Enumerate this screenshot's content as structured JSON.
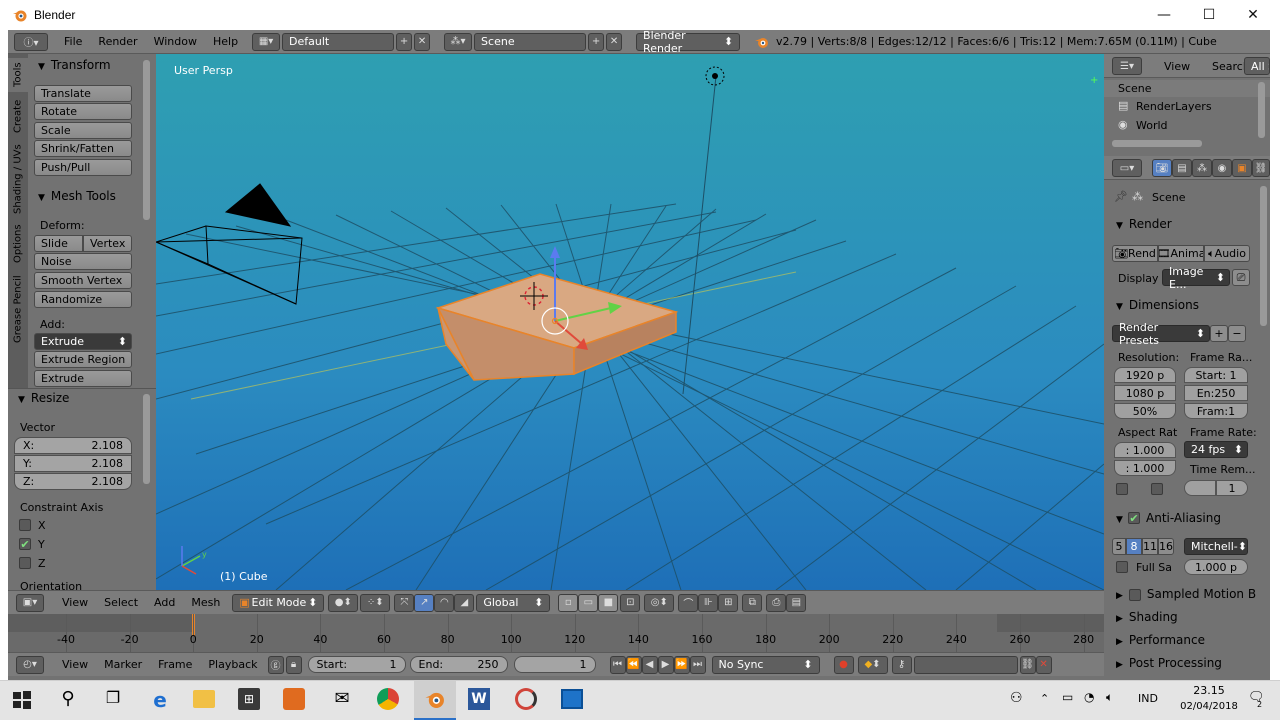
{
  "window": {
    "title": "Blender",
    "minimize": "—",
    "maximize": "☐",
    "close": "✕"
  },
  "infobar": {
    "menus": [
      "File",
      "Render",
      "Window",
      "Help"
    ],
    "layout": "Default",
    "scene": "Scene",
    "engine": "Blender Render",
    "stats": "v2.79 | Verts:8/8 | Edges:12/12 | Faces:6/6 | Tris:12 | Mem:7.65M (0.11M) | Cube"
  },
  "tabs": [
    "Tools",
    "Create",
    "Shading / UVs",
    "Options",
    "Grease Pencil"
  ],
  "toolpanel": {
    "transform_title": "Transform",
    "transform_buttons": [
      "Translate",
      "Rotate",
      "Scale",
      "Shrink/Fatten",
      "Push/Pull"
    ],
    "meshtools_title": "Mesh Tools",
    "deform_label": "Deform:",
    "slide_edge": "Slide Ed",
    "vertex": "Vertex",
    "deform_buttons": [
      "Noise",
      "Smooth Vertex",
      "Randomize"
    ],
    "add_label": "Add:",
    "extrude_select": "Extrude",
    "add_buttons": [
      "Extrude Region",
      "Extrude Individual"
    ]
  },
  "resize": {
    "title": "Resize",
    "vector_label": "Vector",
    "x_label": "X:",
    "x_value": "2.108",
    "y_label": "Y:",
    "y_value": "2.108",
    "z_label": "Z:",
    "z_value": "2.108",
    "constraint_label": "Constraint Axis",
    "axes": [
      "X",
      "Y",
      "Z"
    ],
    "axis_checked": [
      false,
      true,
      false
    ],
    "orientation_label": "Orientation"
  },
  "viewport": {
    "view_name": "User Persp",
    "object_label": "(1) Cube"
  },
  "viewheader": {
    "menus": [
      "View",
      "Select",
      "Add",
      "Mesh"
    ],
    "mode": "Edit Mode",
    "orientation": "Global"
  },
  "timeline": {
    "ticks": [
      "-40",
      "-20",
      "0",
      "20",
      "40",
      "60",
      "80",
      "100",
      "120",
      "140",
      "160",
      "180",
      "200",
      "220",
      "240",
      "260",
      "280"
    ],
    "current_frame_value": 0,
    "menus": [
      "View",
      "Marker",
      "Frame",
      "Playback"
    ],
    "start_label": "Start:",
    "start_value": "1",
    "end_label": "End:",
    "end_value": "250",
    "frame_value": "1",
    "sync": "No Sync"
  },
  "outliner": {
    "menus": [
      "View",
      "Search"
    ],
    "all_scenes": "All Sc",
    "items": [
      "Scene",
      "RenderLayers",
      "World"
    ]
  },
  "properties": {
    "context": "Scene",
    "render_title": "Render",
    "render_buttons": [
      "Rend",
      "Anima",
      "Audio"
    ],
    "display_label": "Display",
    "display_value": "Image E...",
    "dimensions_title": "Dimensions",
    "render_presets": "Render Presets",
    "resolution_label": "Resolution:",
    "res_x": "1920 p",
    "res_y": "1080 p",
    "res_pct": "50%",
    "frame_range_label": "Frame Ra...",
    "frame_start": "Start: 1",
    "frame_end": "En:250",
    "frame_step": "Fram:1",
    "aspect_label": "Aspect Rat",
    "aspect_x": ": 1.000",
    "aspect_y": ": 1.000",
    "frame_rate_label": "Frame Rate:",
    "frame_rate": "24 fps",
    "time_remap_label": "Time Rem...",
    "time_remap_value": "1",
    "aa_title": "Anti-Aliasing",
    "aa_samples": [
      "5",
      "8",
      "11",
      "16"
    ],
    "aa_filter": "Mitchell-",
    "full_sample": "Full Sa",
    "filter_size": "1.000 p",
    "collapsed": [
      "Sampled Motion Blur",
      "Shading",
      "Performance",
      "Post Processing"
    ]
  },
  "taskbar": {
    "lang": "IND",
    "time": "23.15",
    "date": "02/04/2018",
    "notif_count": "2"
  },
  "colors": {
    "accent_orange": "#e8842a",
    "cube_face": "#d9a882",
    "viewport_top": "#2e9fb1",
    "viewport_bottom": "#1e6fb7"
  }
}
